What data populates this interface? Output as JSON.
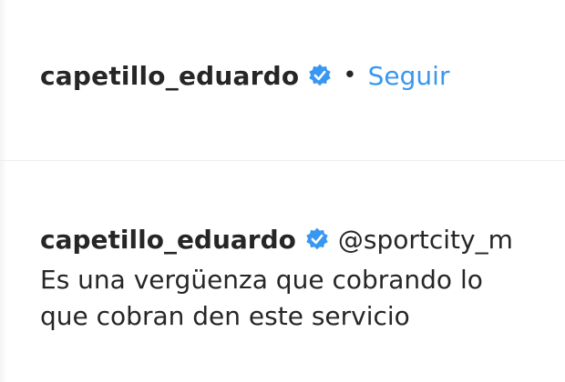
{
  "header": {
    "username": "capetillo_eduardo",
    "separator": "•",
    "follow_label": "Seguir",
    "verified_icon": "verified-badge-icon"
  },
  "comment": {
    "username": "capetillo_eduardo",
    "mention": "@sportcity_m",
    "verified_icon": "verified-badge-icon",
    "lines": [
      "Es una vergüenza que cobrando lo",
      "que cobran den este servicio"
    ]
  },
  "colors": {
    "link_blue": "#3897f0",
    "text": "#262626",
    "verified_blue": "#3897f0",
    "divider": "#efefef"
  }
}
